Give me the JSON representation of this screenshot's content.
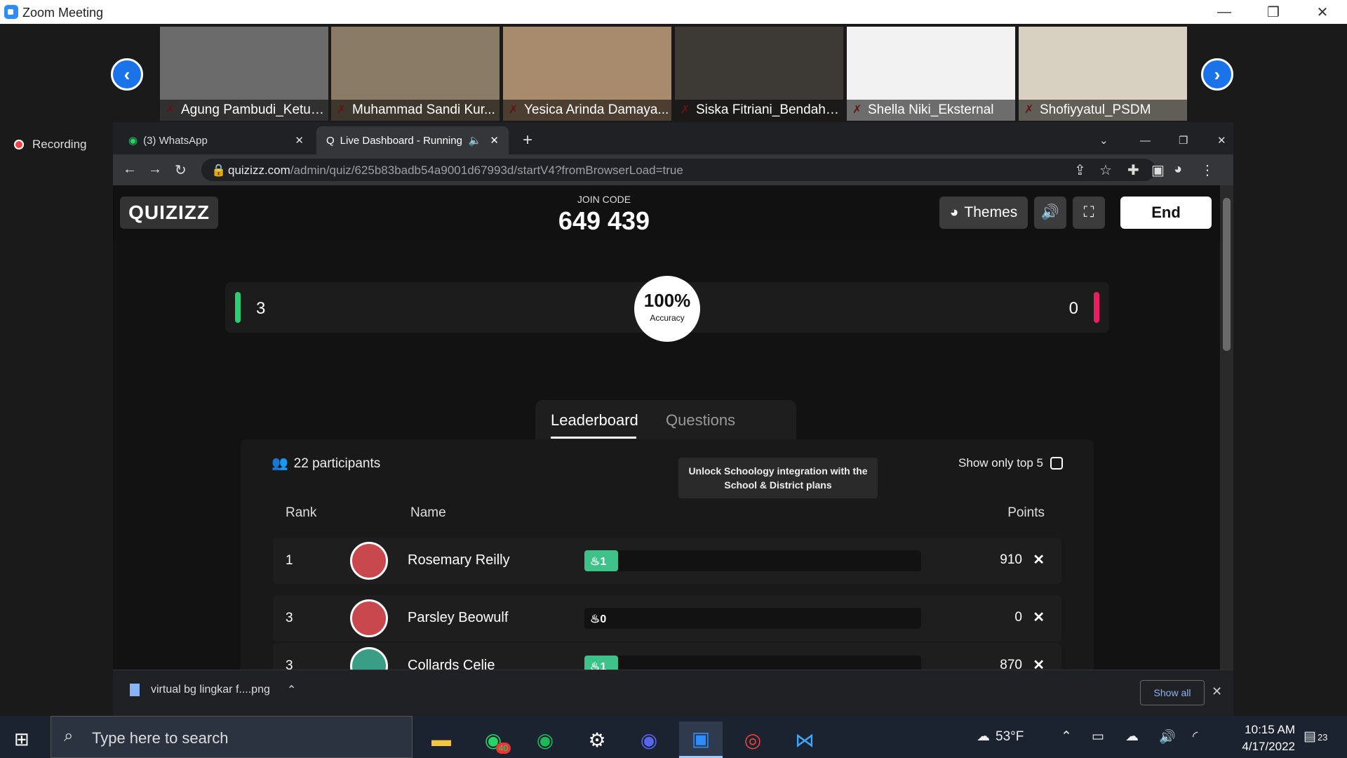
{
  "window": {
    "title": "Zoom Meeting"
  },
  "participants": [
    {
      "name": "Agung Pambudi_Ketua...",
      "bg": "#6b6b6b"
    },
    {
      "name": "Muhammad Sandi Kur...",
      "bg": "#8a7b66"
    },
    {
      "name": "Yesica Arinda Damaya...",
      "bg": "#a88a6c"
    },
    {
      "name": "Siska Fitriani_Bendaha...",
      "bg": "#3d3a36"
    },
    {
      "name": "Shella Niki_Eksternal",
      "bg": "#f2f2f2"
    },
    {
      "name": "Shofiyyatul_PSDM",
      "bg": "#d8d0c0"
    }
  ],
  "recording": {
    "label": "Recording"
  },
  "browser": {
    "tabs": [
      {
        "label": "(3) WhatsApp"
      },
      {
        "label": "Live Dashboard - Running"
      }
    ],
    "url_host": "quizizz.com",
    "url_path": "/admin/quiz/625b83badb54a9001d67993d/startV4?fromBrowserLoad=true"
  },
  "quiz": {
    "logo": "QUIZIZZ",
    "join_label": "JOIN CODE",
    "join_code": "649 439",
    "themes_label": "Themes",
    "end_label": "End",
    "correct": "3",
    "incorrect": "0",
    "accuracy": "100%",
    "accuracy_label": "Accuracy",
    "tab_leaderboard": "Leaderboard",
    "tab_questions": "Questions",
    "participants": "22 participants",
    "show_top": "Show only top 5",
    "tooltip": "Unlock Schoology integration with the School & District plans",
    "col_rank": "Rank",
    "col_name": "Name",
    "col_points": "Points",
    "rows": [
      {
        "rank": "1",
        "name": "Rosemary Reilly",
        "streak": "1",
        "points": "910"
      },
      {
        "rank": "3",
        "name": "Parsley Beowulf",
        "streak": "0",
        "points": "0"
      },
      {
        "rank": "3",
        "name": "Collards Celie",
        "streak": "1",
        "points": "870"
      }
    ]
  },
  "download": {
    "file": "virtual bg lingkar f....png",
    "show_all": "Show all"
  },
  "taskbar": {
    "search_placeholder": "Type here to search",
    "whatsapp_badge": "40",
    "weather": "53°F",
    "time": "10:15 AM",
    "date": "4/17/2022",
    "notif": "23"
  }
}
